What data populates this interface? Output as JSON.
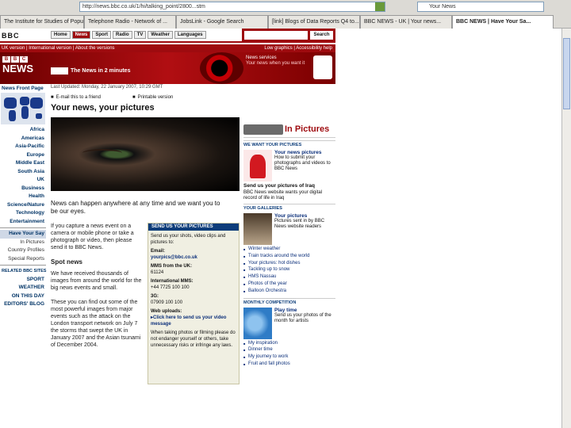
{
  "browser": {
    "address": "http://news.bbc.co.uk/1/hi/talking_point/2800...stm",
    "search_value": "Your News",
    "tabs": [
      "The Institute for Studies of Popul...",
      "Telephone Radio - Network of ...",
      "JobsLink - Google Search",
      "[link] Blogs of Data Reports Q4 to...",
      "BBC NEWS - UK | Your news...",
      "BBC NEWS | Have Your Sa..."
    ]
  },
  "bbc": {
    "logo": "BBC",
    "nav_tabs": [
      "Home",
      "News",
      "Sport",
      "Radio",
      "TV",
      "Weather",
      "Languages"
    ],
    "search_button": "Search",
    "version_left": "UK version  |  International version  |  About the versions",
    "version_right": "Low graphics  |  Accessibility help",
    "news_logo": "NEWS",
    "banner_2min": "The News in 2 minutes",
    "banner_right_title": "News services",
    "banner_right_sub": "Your news when you want it"
  },
  "left_nav": {
    "front_page": "News Front Page",
    "items": [
      "Africa",
      "Americas",
      "Asia-Pacific",
      "Europe",
      "Middle East",
      "South Asia",
      "UK",
      "Business",
      "Health",
      "Science/Nature",
      "Technology",
      "Entertainment"
    ],
    "boxed_item": "Have Your Say",
    "sub_items": [
      "In Pictures",
      "Country Profiles",
      "Special Reports"
    ],
    "related_head": "RELATED BBC SITES",
    "related_items": [
      "SPORT",
      "WEATHER",
      "ON THIS DAY",
      "EDITORS' BLOG"
    ]
  },
  "article": {
    "last_updated": "Last Updated: Monday, 22 January 2007, 10:29 GMT",
    "tool_email": "E-mail this to a friend",
    "tool_print": "Printable version",
    "title": "Your news, your pictures",
    "intro": "News can happen anywhere at any time and we want you to be our eyes.",
    "para1": "If you capture a news event on a camera or mobile phone or take a photograph or video, then please send it to BBC News.",
    "spot_head": "Spot news",
    "para2": "We have received thousands of images from around the world for the big news events and small.",
    "para3": "These you can find out some of the most powerful images from major events such as the attack on the London transport network on July 7 the storms that swept the UK in January 2007 and the Asian tsunami of December 2004."
  },
  "send_box": {
    "header": "SEND US YOUR PICTURES",
    "intro": "Send us your shots, video clips and pictures to:",
    "email_label": "Email:",
    "email": "yourpics@bbc.co.uk",
    "mms_label": "MMS from the UK:",
    "mms": "61124",
    "intl_label": "International MMS:",
    "intl": "+44 7725 100 100",
    "3g_label": "3G:",
    "3g": "07909 100 100",
    "web_label": "Web uploads:",
    "web_link": "Click here to send us your video message",
    "note": "When taking photos or filming please do not endanger yourself or others, take unnecessary risks or infringe any laws."
  },
  "right_col": {
    "in_pictures": "In Pictures",
    "want_head": "We want your pictures",
    "feature1_title": "Your news pictures",
    "feature1_text": "How to submit your photographs and videos to BBC News",
    "iraq_big": "Send us your pictures of Iraq",
    "iraq_text": "BBC News website wants your digital record of life in Iraq",
    "gallery_head": "Your galleries",
    "feature2_title": "Your pictures",
    "feature2_text": "Pictures sent in by BBC News website readers",
    "gallery_links": [
      "Winter weather",
      "Train tracks around the world",
      "Your pictures: hot dishes",
      "Tackling up to snow",
      "HMS Nassau",
      "Photos of the year",
      "Balloon Orchestra"
    ],
    "monthly_head": "Monthly competition",
    "feature3_title": "Play time",
    "feature3_text": "Send us your photos of the month for artists",
    "monthly_links": [
      "My inspiration",
      "Dinner time",
      "My journey to work",
      "Fruit and fall photos"
    ]
  },
  "colors": {
    "bbc_red": "#9e0b0f",
    "link_blue": "#0b2f7a"
  }
}
